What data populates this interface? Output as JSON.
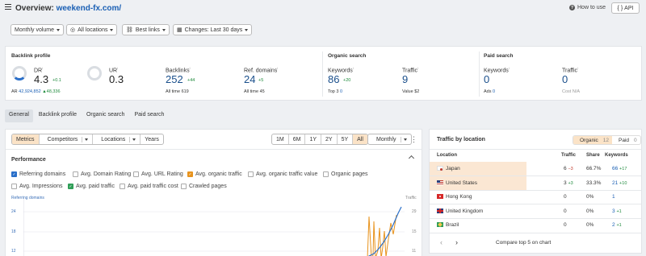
{
  "header": {
    "title_prefix": "Overview: ",
    "domain": "weekend-fx.com/",
    "how_to_use": "How to use",
    "api": "API"
  },
  "filters": {
    "volume": "Monthly volume",
    "locations": "All locations",
    "links": "Best links",
    "changes": "Changes: Last 30 days"
  },
  "backlink_profile": {
    "title": "Backlink profile",
    "dr": {
      "label": "DR",
      "value": "4.3",
      "delta": "+0.1"
    },
    "ar": {
      "label": "AR",
      "value": "42,924,852",
      "delta": "▲48,336"
    },
    "ur": {
      "label": "UR",
      "value": "0.3"
    },
    "backlinks": {
      "label": "Backlinks",
      "value": "252",
      "delta": "+44",
      "all_time_label": "All time",
      "all_time": "619"
    },
    "ref_domains": {
      "label": "Ref. domains",
      "value": "24",
      "delta": "+5",
      "all_time_label": "All time",
      "all_time": "45"
    }
  },
  "organic_search": {
    "title": "Organic search",
    "keywords": {
      "label": "Keywords",
      "value": "86",
      "delta": "+20",
      "top3_label": "Top 3",
      "top3": "0"
    },
    "traffic": {
      "label": "Traffic",
      "value": "9",
      "value_label": "Value",
      "value_amt": "$2"
    }
  },
  "paid_search": {
    "title": "Paid search",
    "keywords": {
      "label": "Keywords",
      "value": "0",
      "ads_label": "Ads",
      "ads": "0"
    },
    "traffic": {
      "label": "Traffic",
      "value": "0",
      "cost": "Cost N/A"
    }
  },
  "subtabs": [
    "General",
    "Backlink profile",
    "Organic search",
    "Paid search"
  ],
  "left_panel": {
    "tabs": [
      "Metrics",
      "Competitors",
      "Locations",
      "Years"
    ],
    "ranges": [
      "1M",
      "6M",
      "1Y",
      "2Y",
      "5Y",
      "All"
    ],
    "interval": "Monthly",
    "performance": "Performance",
    "checkboxes": [
      {
        "label": "Referring domains",
        "state": "blue"
      },
      {
        "label": "Avg. Domain Rating",
        "state": "off"
      },
      {
        "label": "Avg. URL Rating",
        "state": "off"
      },
      {
        "label": "Avg. organic traffic",
        "state": "orange"
      },
      {
        "label": "Avg. organic traffic value",
        "state": "off"
      },
      {
        "label": "Organic pages",
        "state": "off"
      },
      {
        "label": "Avg. Impressions",
        "state": "off"
      },
      {
        "label": "Avg. paid traffic",
        "state": "green"
      },
      {
        "label": "Avg. paid traffic cost",
        "state": "off"
      },
      {
        "label": "Crawled pages",
        "state": "off"
      }
    ],
    "axis_left_title": "Referring domains",
    "axis_right_title": "Traffic",
    "left_ticks": [
      "24",
      "18",
      "12"
    ],
    "right_ticks": [
      "29",
      "15",
      "11"
    ]
  },
  "right_panel": {
    "title": "Traffic by location",
    "organic_label": "Organic",
    "organic_count": "12",
    "paid_label": "Paid",
    "paid_count": "0",
    "columns": [
      "Location",
      "Traffic",
      "Share",
      "Keywords"
    ],
    "rows": [
      {
        "flag": "japan",
        "name": "Japan",
        "traffic": "6",
        "traffic_delta": "−3",
        "share": "66.7%",
        "keywords": "66",
        "kw_delta": "+17"
      },
      {
        "flag": "us",
        "name": "United States",
        "traffic": "3",
        "traffic_delta": "+3",
        "share": "33.3%",
        "keywords": "21",
        "kw_delta": "+10"
      },
      {
        "flag": "hk",
        "name": "Hong Kong",
        "traffic": "0",
        "traffic_delta": "",
        "share": "0%",
        "keywords": "1",
        "kw_delta": ""
      },
      {
        "flag": "uk",
        "name": "United Kingdom",
        "traffic": "0",
        "traffic_delta": "",
        "share": "0%",
        "keywords": "3",
        "kw_delta": "+1"
      },
      {
        "flag": "br",
        "name": "Brazil",
        "traffic": "0",
        "traffic_delta": "",
        "share": "0%",
        "keywords": "2",
        "kw_delta": "+1"
      }
    ],
    "compare": "Compare top 5 on chart"
  },
  "colors": {
    "accent_orange": "#e8931d",
    "ref_domains_blue": "#2a6fc9",
    "paid_green": "#2f9e57",
    "selected_bg": "#fbe3c7"
  }
}
